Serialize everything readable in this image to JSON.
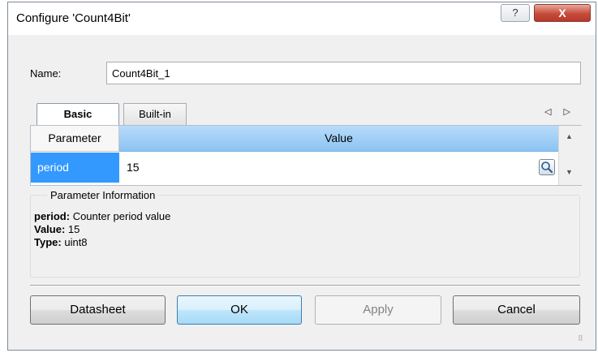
{
  "window": {
    "title": "Configure 'Count4Bit'"
  },
  "titlebar_buttons": {
    "help_glyph": "?",
    "close_glyph": "X"
  },
  "name": {
    "label": "Name:",
    "value": "Count4Bit_1"
  },
  "tabs": [
    {
      "label": "Basic",
      "active": true
    },
    {
      "label": "Built-in",
      "active": false
    }
  ],
  "tab_scroll_glyphs": "◁ ▷",
  "grid": {
    "headers": {
      "parameter": "Parameter",
      "value": "Value"
    },
    "rows": [
      {
        "parameter": "period",
        "value": "15"
      }
    ]
  },
  "parameter_info": {
    "legend": "Parameter Information",
    "name_key": "period:",
    "name_desc": "Counter period value",
    "value_key": "Value:",
    "value": "15",
    "type_key": "Type:",
    "type": "uint8"
  },
  "buttons": {
    "datasheet": "Datasheet",
    "ok": "OK",
    "apply": "Apply",
    "cancel": "Cancel"
  },
  "icons": {
    "help": "help-icon",
    "close": "close-icon",
    "lookup": "magnifier-icon",
    "scroll_up": "scroll-up-arrow-icon",
    "scroll_down": "scroll-down-arrow-icon",
    "resize": "resize-grip-icon"
  },
  "colors": {
    "selection": "#3399ff",
    "header_value": "#8cc4f2",
    "close_button": "#c74b3b",
    "ok_border": "#3c7fb1"
  }
}
